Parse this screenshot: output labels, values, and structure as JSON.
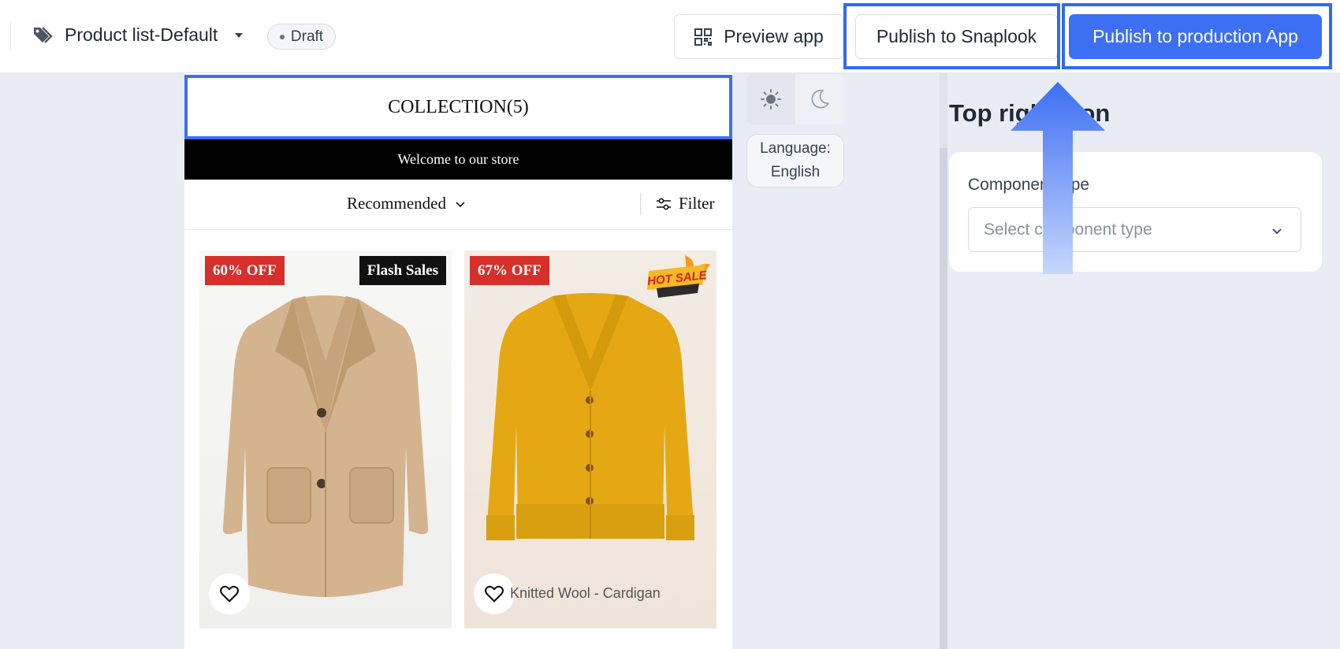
{
  "header": {
    "page_name": "Product list-Default",
    "status": "Draft",
    "preview_label": "Preview app",
    "publish_snaplook_label": "Publish to Snaplook",
    "publish_production_label": "Publish to production App"
  },
  "preview": {
    "collection_title": "COLLECTION(5)",
    "welcome_text": "Welcome to our store",
    "sort_label": "Recommended",
    "filter_label": "Filter",
    "products": [
      {
        "discount": "60% OFF",
        "badge": "Flash Sales",
        "name": ""
      },
      {
        "discount": "67% OFF",
        "badge": "HOT SALE",
        "name": "Knitted Wool - Cardigan"
      }
    ]
  },
  "theme": {
    "language_label": "Language:",
    "language_value": "English"
  },
  "settings": {
    "title": "Top right icon",
    "field_label": "Component type",
    "select_placeholder": "Select component type"
  },
  "colors": {
    "accent": "#3d6ff3",
    "highlight": "#2f6bf1",
    "discount": "#d6302a",
    "background": "#e9ecf5"
  },
  "icons": {
    "tag": "tag-icon",
    "qr": "qr-code-icon",
    "sun": "sun-icon",
    "moon": "moon-icon",
    "heart": "heart-icon",
    "filter": "sliders-icon",
    "chevron": "chevron-down-icon"
  }
}
